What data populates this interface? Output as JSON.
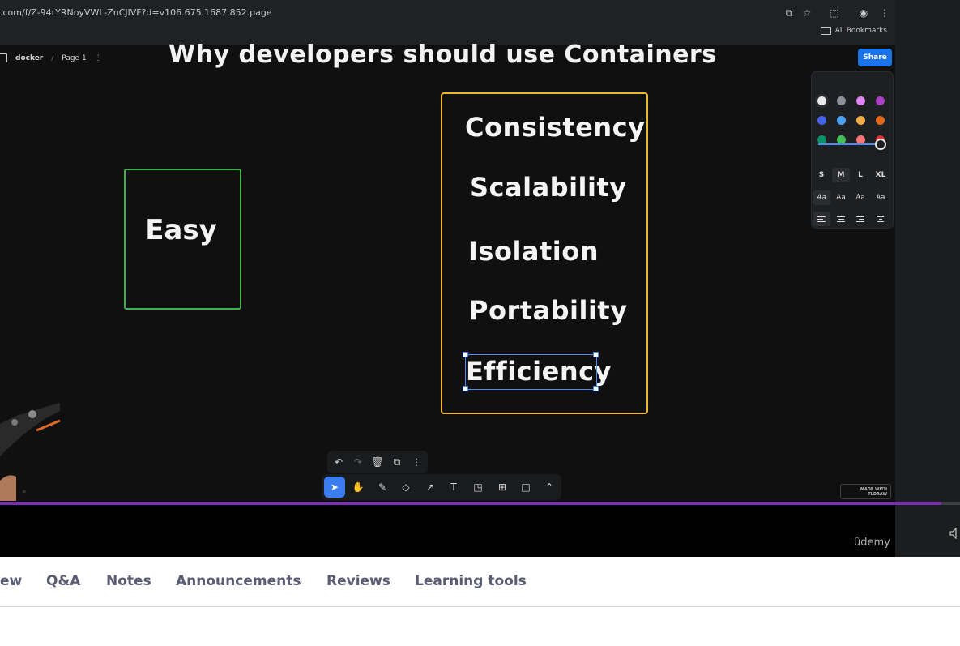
{
  "browser": {
    "url": ".com/f/Z-94rYRNoyVWL-ZnCJlVF?d=v106.675.1687.852.page",
    "bookmarks_label": "All Bookmarks"
  },
  "tldraw": {
    "doc_name": "docker",
    "separator": "/",
    "page_name": "Page 1",
    "share_label": "Share",
    "title": "Why developers should use Containers",
    "easy_label": "Easy",
    "benefits": [
      "Consistency",
      "Scalability",
      "Isolation",
      "Portability",
      "Efficiency"
    ],
    "colors": [
      "#e8e8e8",
      "#8e8f99",
      "#e085f4",
      "#ae3ec9",
      "#4465e9",
      "#4ba1f1",
      "#f1ac4b",
      "#e16919",
      "#099268",
      "#40c057",
      "#f87777",
      "#e03131"
    ],
    "sizes": [
      "S",
      "M",
      "L",
      "XL"
    ],
    "selected_size": "M",
    "fonts": [
      "Aa",
      "Aa",
      "Aa",
      "Aa"
    ],
    "badge_text": "MADE WITH TLDRAW"
  },
  "player": {
    "progress": 0.981,
    "logo": "ûdemy"
  },
  "tabs": [
    "ew",
    "Q&A",
    "Notes",
    "Announcements",
    "Reviews",
    "Learning tools"
  ]
}
